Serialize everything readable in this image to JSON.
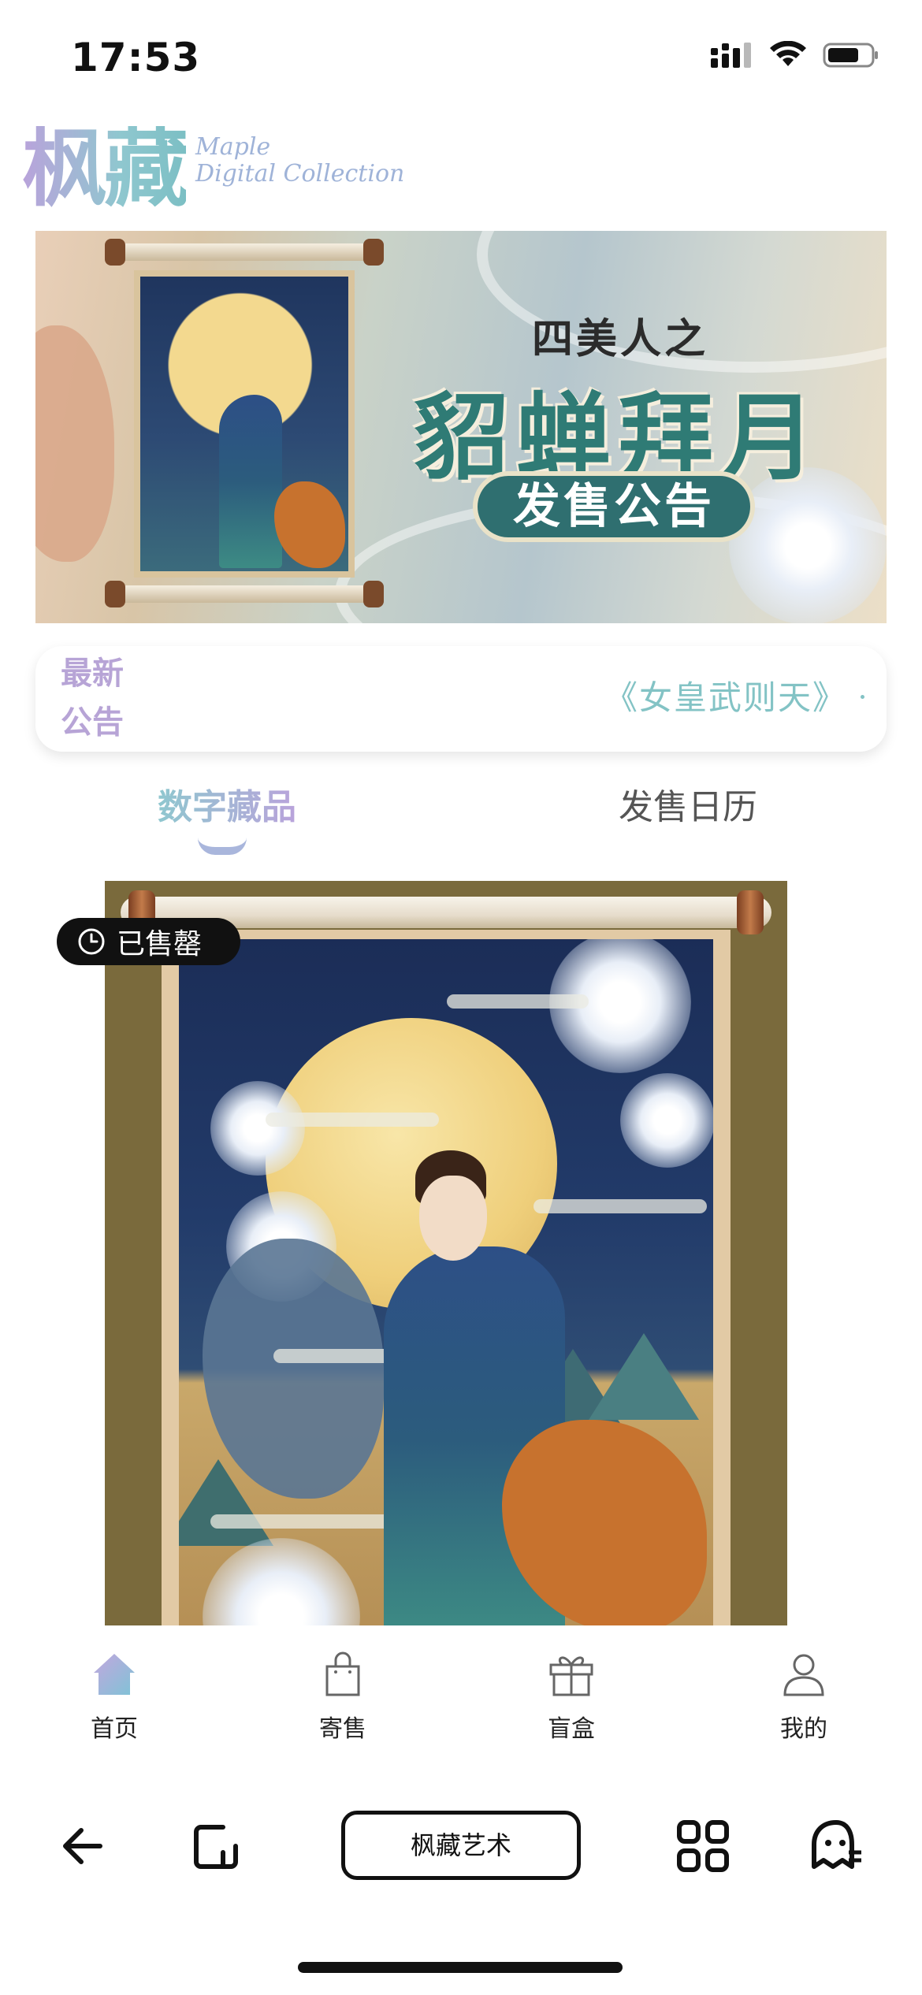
{
  "status_bar": {
    "time": "17:53"
  },
  "logo": {
    "cn": "枫藏",
    "en_line1": "Maple",
    "en_line2": "Digital Collection"
  },
  "banner": {
    "subtitle": "四美人之",
    "title": "貂蝉拜月",
    "pill": "发售公告"
  },
  "notice": {
    "label": "最新公告",
    "text": "《女皇武则天》"
  },
  "tabs": [
    {
      "label": "数字藏品",
      "active": true
    },
    {
      "label": "发售日历",
      "active": false
    }
  ],
  "collection_card": {
    "badge": "已售罄"
  },
  "bottom_nav": [
    {
      "label": "首页",
      "icon": "home-icon",
      "active": true
    },
    {
      "label": "寄售",
      "icon": "shopping-bag-icon",
      "active": false
    },
    {
      "label": "盲盒",
      "icon": "gift-icon",
      "active": false
    },
    {
      "label": "我的",
      "icon": "user-icon",
      "active": false
    }
  ],
  "browser_bar": {
    "title": "枫藏艺术"
  },
  "colors": {
    "accent_teal": "#83c3c5",
    "accent_lavender": "#b7a4d6",
    "active_nav": "#8fa8df"
  }
}
